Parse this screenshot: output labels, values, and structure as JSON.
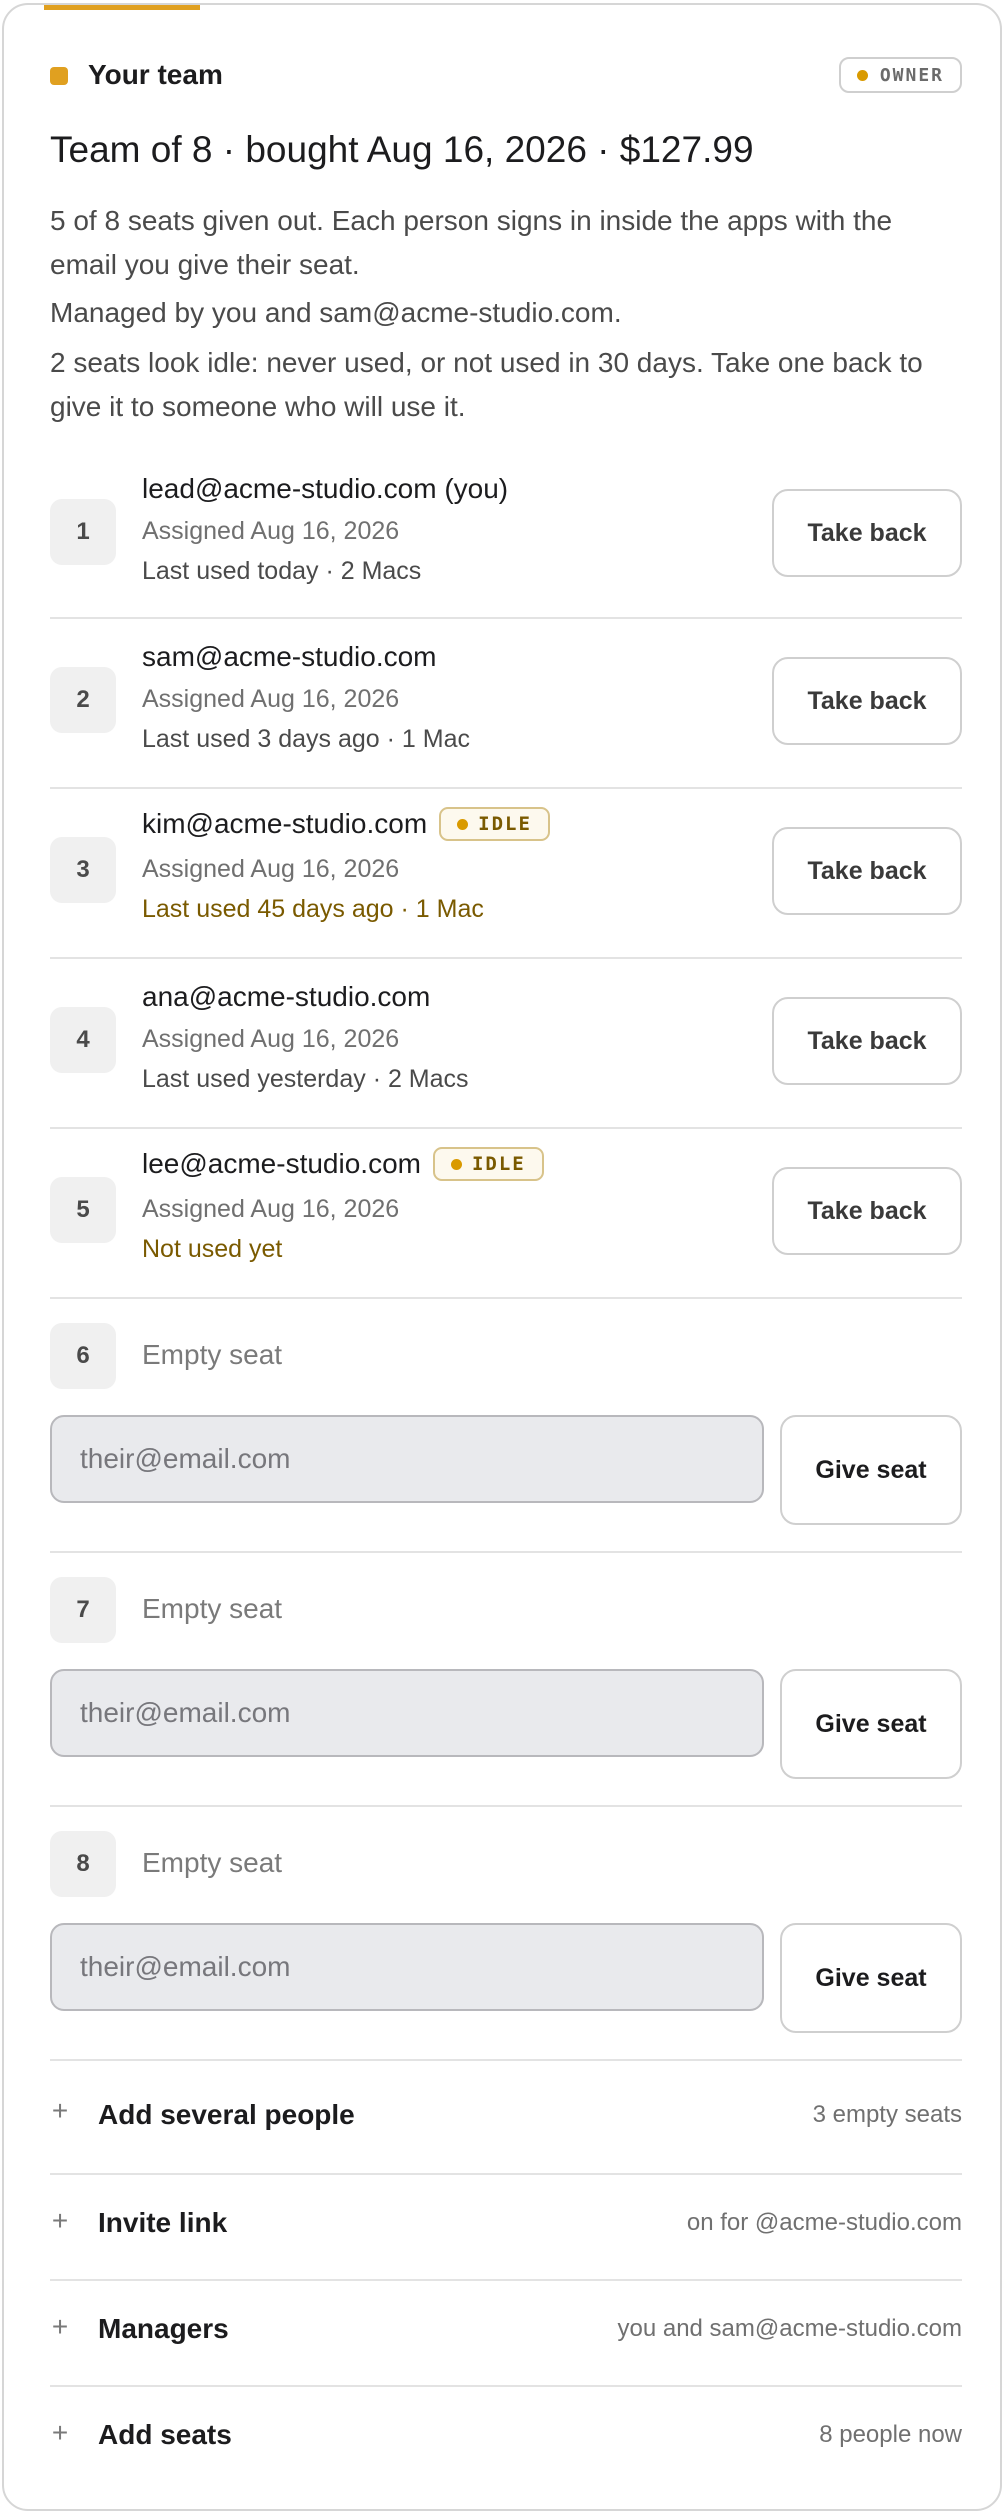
{
  "header": {
    "title": "Your team",
    "role_badge": "OWNER"
  },
  "summary": {
    "title": "Team of 8 · bought Aug 16, 2026 · $127.99",
    "line1": "5 of 8 seats given out. Each person signs in inside the apps with the email you give their seat.",
    "line2": "Managed by you and sam@acme-studio.com.",
    "line3": "2 seats look idle: never used, or not used in 30 days. Take one back to give it to someone who will use it."
  },
  "colors": {
    "accent": "#e0a020",
    "idle_text": "#7a5a00"
  },
  "seats": [
    {
      "number": "1",
      "email": "lead@acme-studio.com (you)",
      "assigned": "Assigned Aug 16, 2026",
      "usage": "Last used today · 2 Macs",
      "idle": false,
      "button": "Take back"
    },
    {
      "number": "2",
      "email": "sam@acme-studio.com",
      "assigned": "Assigned Aug 16, 2026",
      "usage": "Last used 3 days ago · 1 Mac",
      "idle": false,
      "button": "Take back"
    },
    {
      "number": "3",
      "email": "kim@acme-studio.com",
      "assigned": "Assigned Aug 16, 2026",
      "usage": "Last used 45 days ago · 1 Mac",
      "idle": true,
      "idle_label": "IDLE",
      "button": "Take back"
    },
    {
      "number": "4",
      "email": "ana@acme-studio.com",
      "assigned": "Assigned Aug 16, 2026",
      "usage": "Last used yesterday · 2 Macs",
      "idle": false,
      "button": "Take back"
    },
    {
      "number": "5",
      "email": "lee@acme-studio.com",
      "assigned": "Assigned Aug 16, 2026",
      "usage": "Not used yet",
      "idle": true,
      "idle_label": "IDLE",
      "button": "Take back"
    }
  ],
  "empty_seats": [
    {
      "number": "6",
      "label": "Empty seat",
      "placeholder": "their@email.com",
      "value": "",
      "button": "Give seat"
    },
    {
      "number": "7",
      "label": "Empty seat",
      "placeholder": "their@email.com",
      "value": "",
      "button": "Give seat"
    },
    {
      "number": "8",
      "label": "Empty seat",
      "placeholder": "their@email.com",
      "value": "",
      "button": "Give seat"
    }
  ],
  "sections": [
    {
      "label": "Add several people",
      "meta": "3 empty seats",
      "icon": "plus-icon"
    },
    {
      "label": "Invite link",
      "meta": "on for @acme-studio.com",
      "icon": "plus-icon"
    },
    {
      "label": "Managers",
      "meta": "you and sam@acme-studio.com",
      "icon": "plus-icon"
    },
    {
      "label": "Add seats",
      "meta": "8 people now",
      "icon": "plus-icon"
    }
  ]
}
